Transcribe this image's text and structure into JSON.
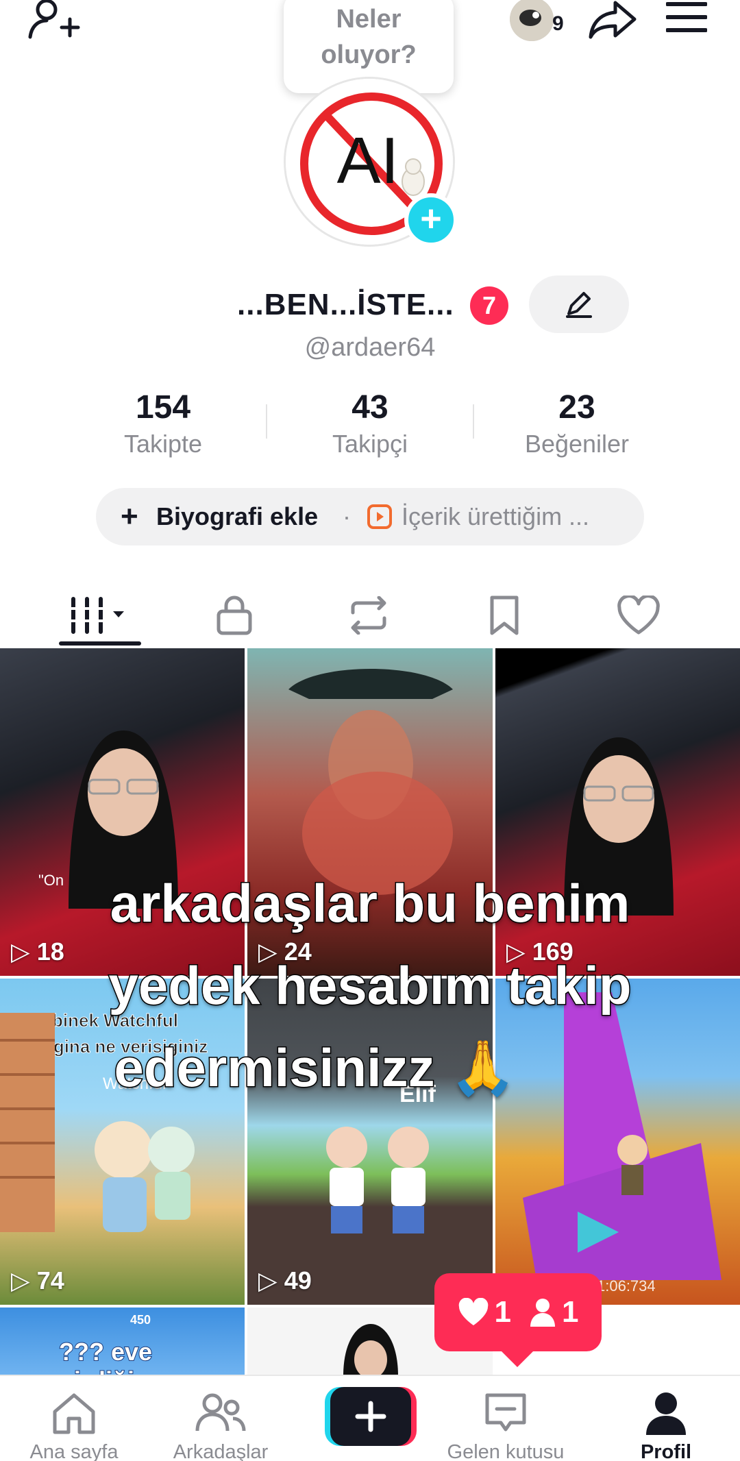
{
  "top_bar": {
    "notification_count": "9",
    "bubble_line1": "Neler",
    "bubble_line2": "oluyor?"
  },
  "profile": {
    "avatar_text": "AI",
    "display_name": "...BEN...İSTE...",
    "name_badge": "7",
    "handle": "@ardaer64",
    "stats": [
      {
        "value": "154",
        "label": "Takipte"
      },
      {
        "value": "43",
        "label": "Takipçi"
      },
      {
        "value": "23",
        "label": "Beğeniler"
      }
    ],
    "bio_add_label": "Biyografi ekle",
    "bio_separator": "·",
    "bio_creator_label": "İçerik ürettiğim ..."
  },
  "colors": {
    "accent_pink": "#fe2c55",
    "accent_cyan": "#20d5ec",
    "text_dark": "#161823",
    "text_grey": "#8a8b91"
  },
  "tabs": [
    {
      "icon": "grid-icon",
      "active": true
    },
    {
      "icon": "lock-icon"
    },
    {
      "icon": "repost-icon"
    },
    {
      "icon": "bookmark-icon"
    },
    {
      "icon": "heart-icon"
    }
  ],
  "videos": [
    {
      "views": "18",
      "caption": "\"On"
    },
    {
      "views": "24"
    },
    {
      "views": "169"
    },
    {
      "views": "74",
      "caption_line1": "binek Watchful",
      "caption_line2": "ayicigina ne verisiginiz",
      "caption_line3": "Watchful"
    },
    {
      "views": "49",
      "caption": "Elif"
    },
    {
      "views": "",
      "timer": "1:06:734"
    },
    {
      "caption": "??? eve girdiğin",
      "small_numbers": "450"
    },
    {}
  ],
  "overlay_caption": {
    "line1": "arkadaşlar bu benim",
    "line2": "yedek hesabım takip",
    "line3": "edermisinizz 🙏"
  },
  "activity_popup": {
    "likes": "1",
    "followers": "1"
  },
  "bottom_nav": [
    {
      "label": "Ana sayfa",
      "icon": "home-icon"
    },
    {
      "label": "Arkadaşlar",
      "icon": "friends-icon"
    },
    {
      "label": "",
      "icon": "create-icon"
    },
    {
      "label": "Gelen kutusu",
      "icon": "inbox-icon"
    },
    {
      "label": "Profil",
      "icon": "profile-icon",
      "active": true
    }
  ]
}
